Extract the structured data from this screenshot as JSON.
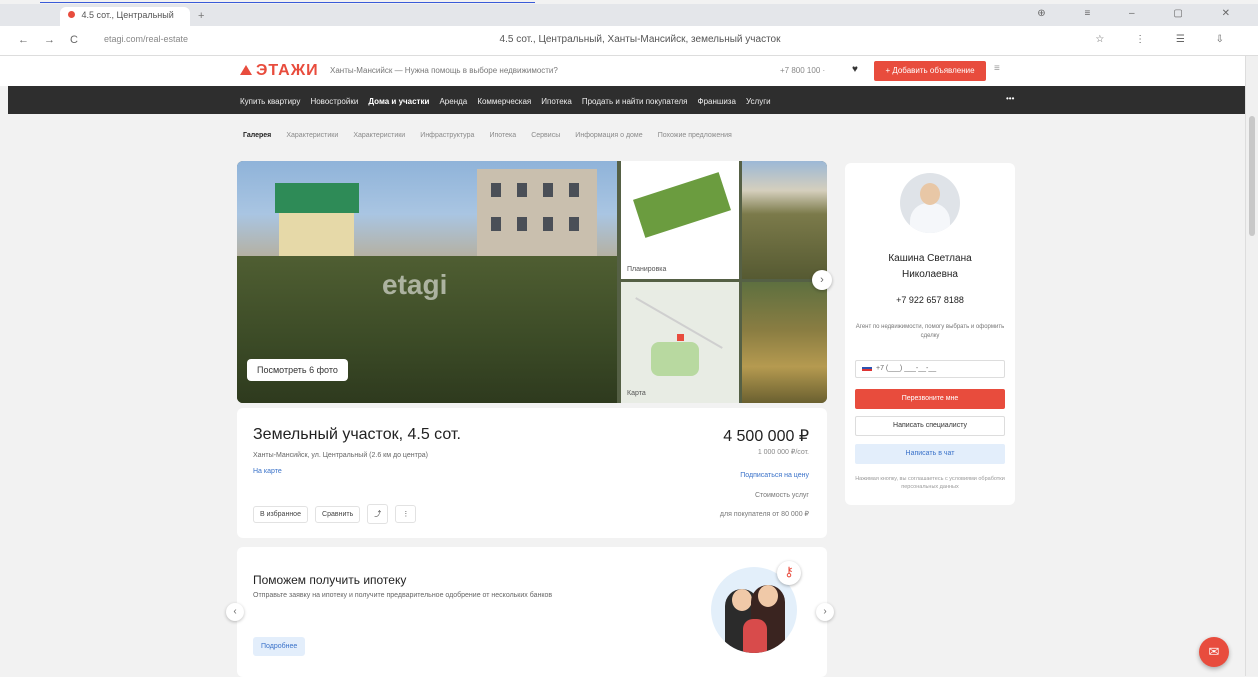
{
  "browser": {
    "tab_title": "4.5 сот., Центральный",
    "new_tab_icon": "+",
    "window_controls": "⊕ ≡ – ▢ ✕",
    "url": "etagi.com/real-estate",
    "page_title": "4.5 сот., Центральный, Ханты-Мансийск, земельный участок",
    "nav_icons": {
      "back": "←",
      "forward": "→",
      "reload": "C"
    },
    "right_icons": "☆ ⋮ ☰ ⇩"
  },
  "site": {
    "logo": "ЭТАЖИ",
    "city": "Ханты-Мансийск — Нужна помощь в выборе недвижимости?",
    "phone": "+7 800 100 ·",
    "heart_icon": "♥",
    "cta_button": "+ Добавить объявление",
    "menu_icon": "≡"
  },
  "main_nav": {
    "items": [
      "Купить квартиру",
      "Новостройки",
      "Дома и участки",
      "Аренда",
      "Коммерческая",
      "Ипотека",
      "Продать и найти покупателя",
      "Франшиза",
      "Услуги"
    ],
    "active_index": 2,
    "right": "•••"
  },
  "sub_nav": {
    "items": [
      "Галерея",
      "Характеристики",
      "Характеристики",
      "Инфраструктура",
      "Ипотека",
      "Сервисы",
      "Информация о доме",
      "Похожие предложения"
    ],
    "active_index": 0
  },
  "gallery": {
    "watermark": "etagi",
    "view_button": "Посмотреть 6 фото",
    "thumb_plan_label": "Планировка",
    "thumb_map_label": "Карта",
    "next_icon": "›"
  },
  "listing": {
    "title": "Земельный участок, 4.5 сот.",
    "address": "Ханты-Мансийск, ул. Центральный (2.6 км до центра)",
    "district": "На карте",
    "actions": [
      "В избранное",
      "Сравнить",
      "⤴",
      "⋮"
    ],
    "price": "4 500 000 ₽",
    "price_per_m": "1 000 000 ₽/сот.",
    "price_link": "Подписаться на цену",
    "mortgage_line1": "Стоимость услуг",
    "mortgage_line2": "для покупателя от 80 000 ₽"
  },
  "loan": {
    "title": "Поможем получить ипотеку",
    "text": "Отправьте заявку на ипотеку и получите предварительное одобрение от нескольких банков",
    "button": "Подробнее",
    "key_icon": "⚷",
    "prev_icon": "‹",
    "next_icon": "›"
  },
  "agent": {
    "name_line1": "Кашина Светлана",
    "name_line2": "Николаевна",
    "phone": "+7 922 657 8188",
    "note": "Агент по недвижимости, помогу выбрать и оформить сделку",
    "phone_placeholder": "+7 (___) ___-__-__",
    "call_button": "Перезвоните мне",
    "reply_button": "Написать специалисту",
    "message_button": "Написать в чат",
    "footer": "Нажимая кнопку, вы соглашаетесь с условиями обработки персональных данных"
  },
  "chat_icon": "✉"
}
